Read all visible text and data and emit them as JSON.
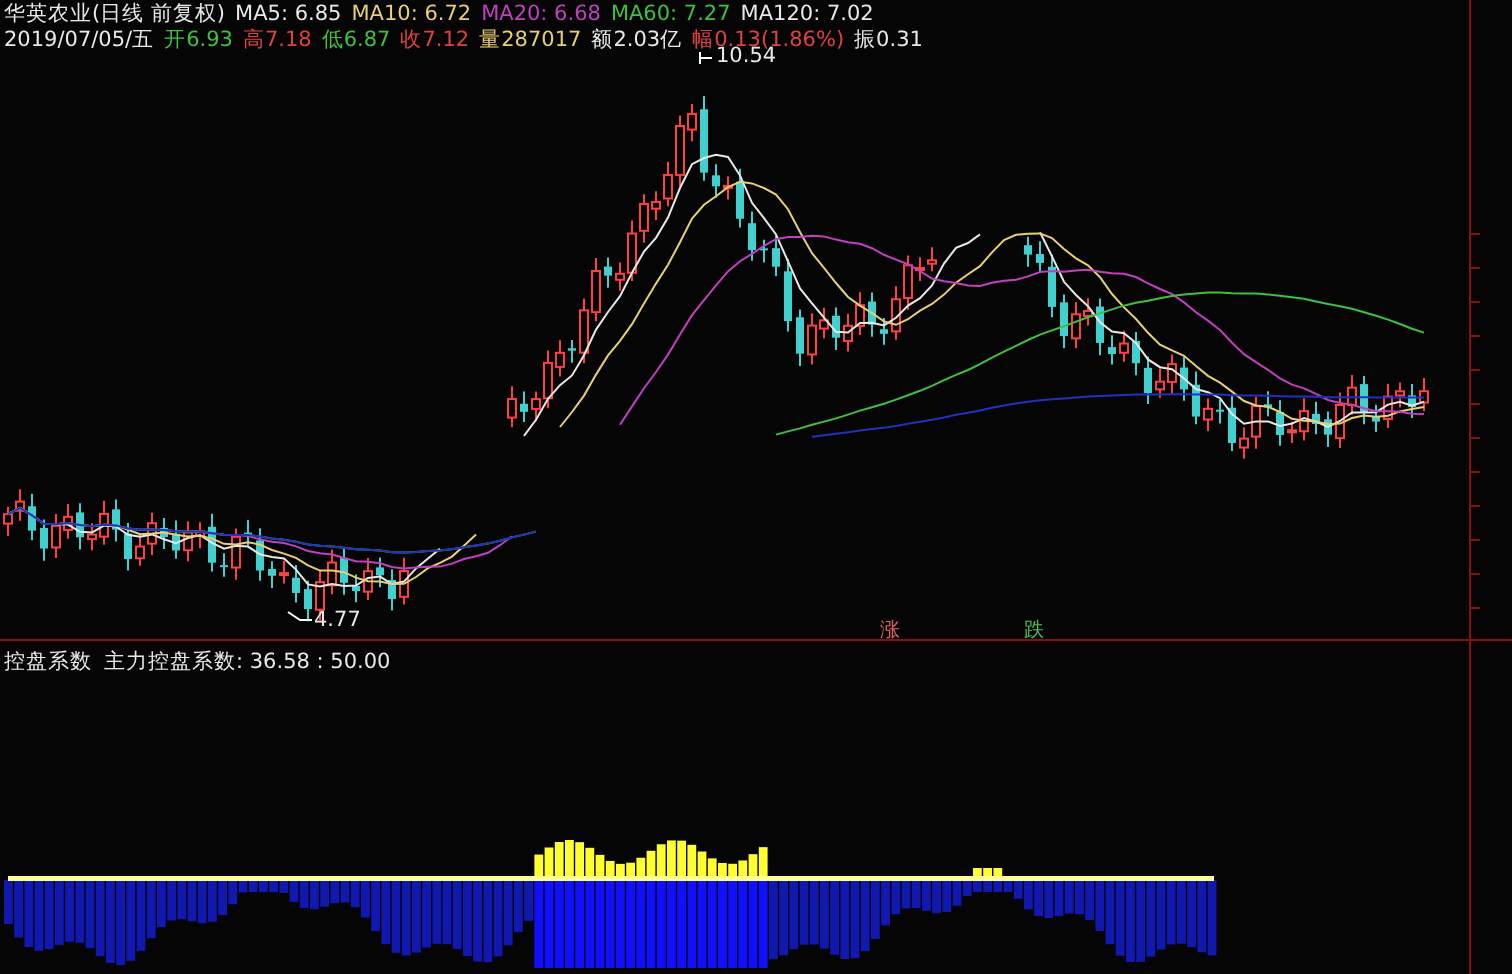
{
  "header": {
    "title": "华英农业(日线 前复权)",
    "moving_averages": [
      {
        "label": "MA5: 6.85",
        "color": "#e8e8e8"
      },
      {
        "label": "MA10: 6.72",
        "color": "#e8d070"
      },
      {
        "label": "MA20: 6.68",
        "color": "#c040c0"
      },
      {
        "label": "MA60: 7.27",
        "color": "#40c040"
      },
      {
        "label": "MA120: 7.02",
        "color": "#e8e8e8"
      }
    ],
    "date": "2019/07/05/五",
    "quotes": [
      {
        "label": "开",
        "value": "6.93",
        "color": "#40c040"
      },
      {
        "label": "高",
        "value": "7.18",
        "color": "#e04040"
      },
      {
        "label": "低",
        "value": "6.87",
        "color": "#40c040"
      },
      {
        "label": "收",
        "value": "7.12",
        "color": "#e04040"
      },
      {
        "label": "量",
        "value": "287017",
        "color": "#e8d070"
      },
      {
        "label": "额",
        "value": "2.03亿",
        "color": "#e8e8e8"
      },
      {
        "label": "幅",
        "value": "0.13(1.86%)",
        "color": "#e04040"
      },
      {
        "label": "振",
        "value": "0.31",
        "color": "#e8e8e8"
      }
    ]
  },
  "price_chart": {
    "high_label": "10.54",
    "low_label": "4.77",
    "markers": [
      {
        "text": "涨",
        "color": "#e06060"
      },
      {
        "text": "跌",
        "color": "#50c050"
      }
    ]
  },
  "indicator": {
    "name": "控盘系数",
    "readout": "主力控盘系数: 36.58 : 50.00"
  }
}
